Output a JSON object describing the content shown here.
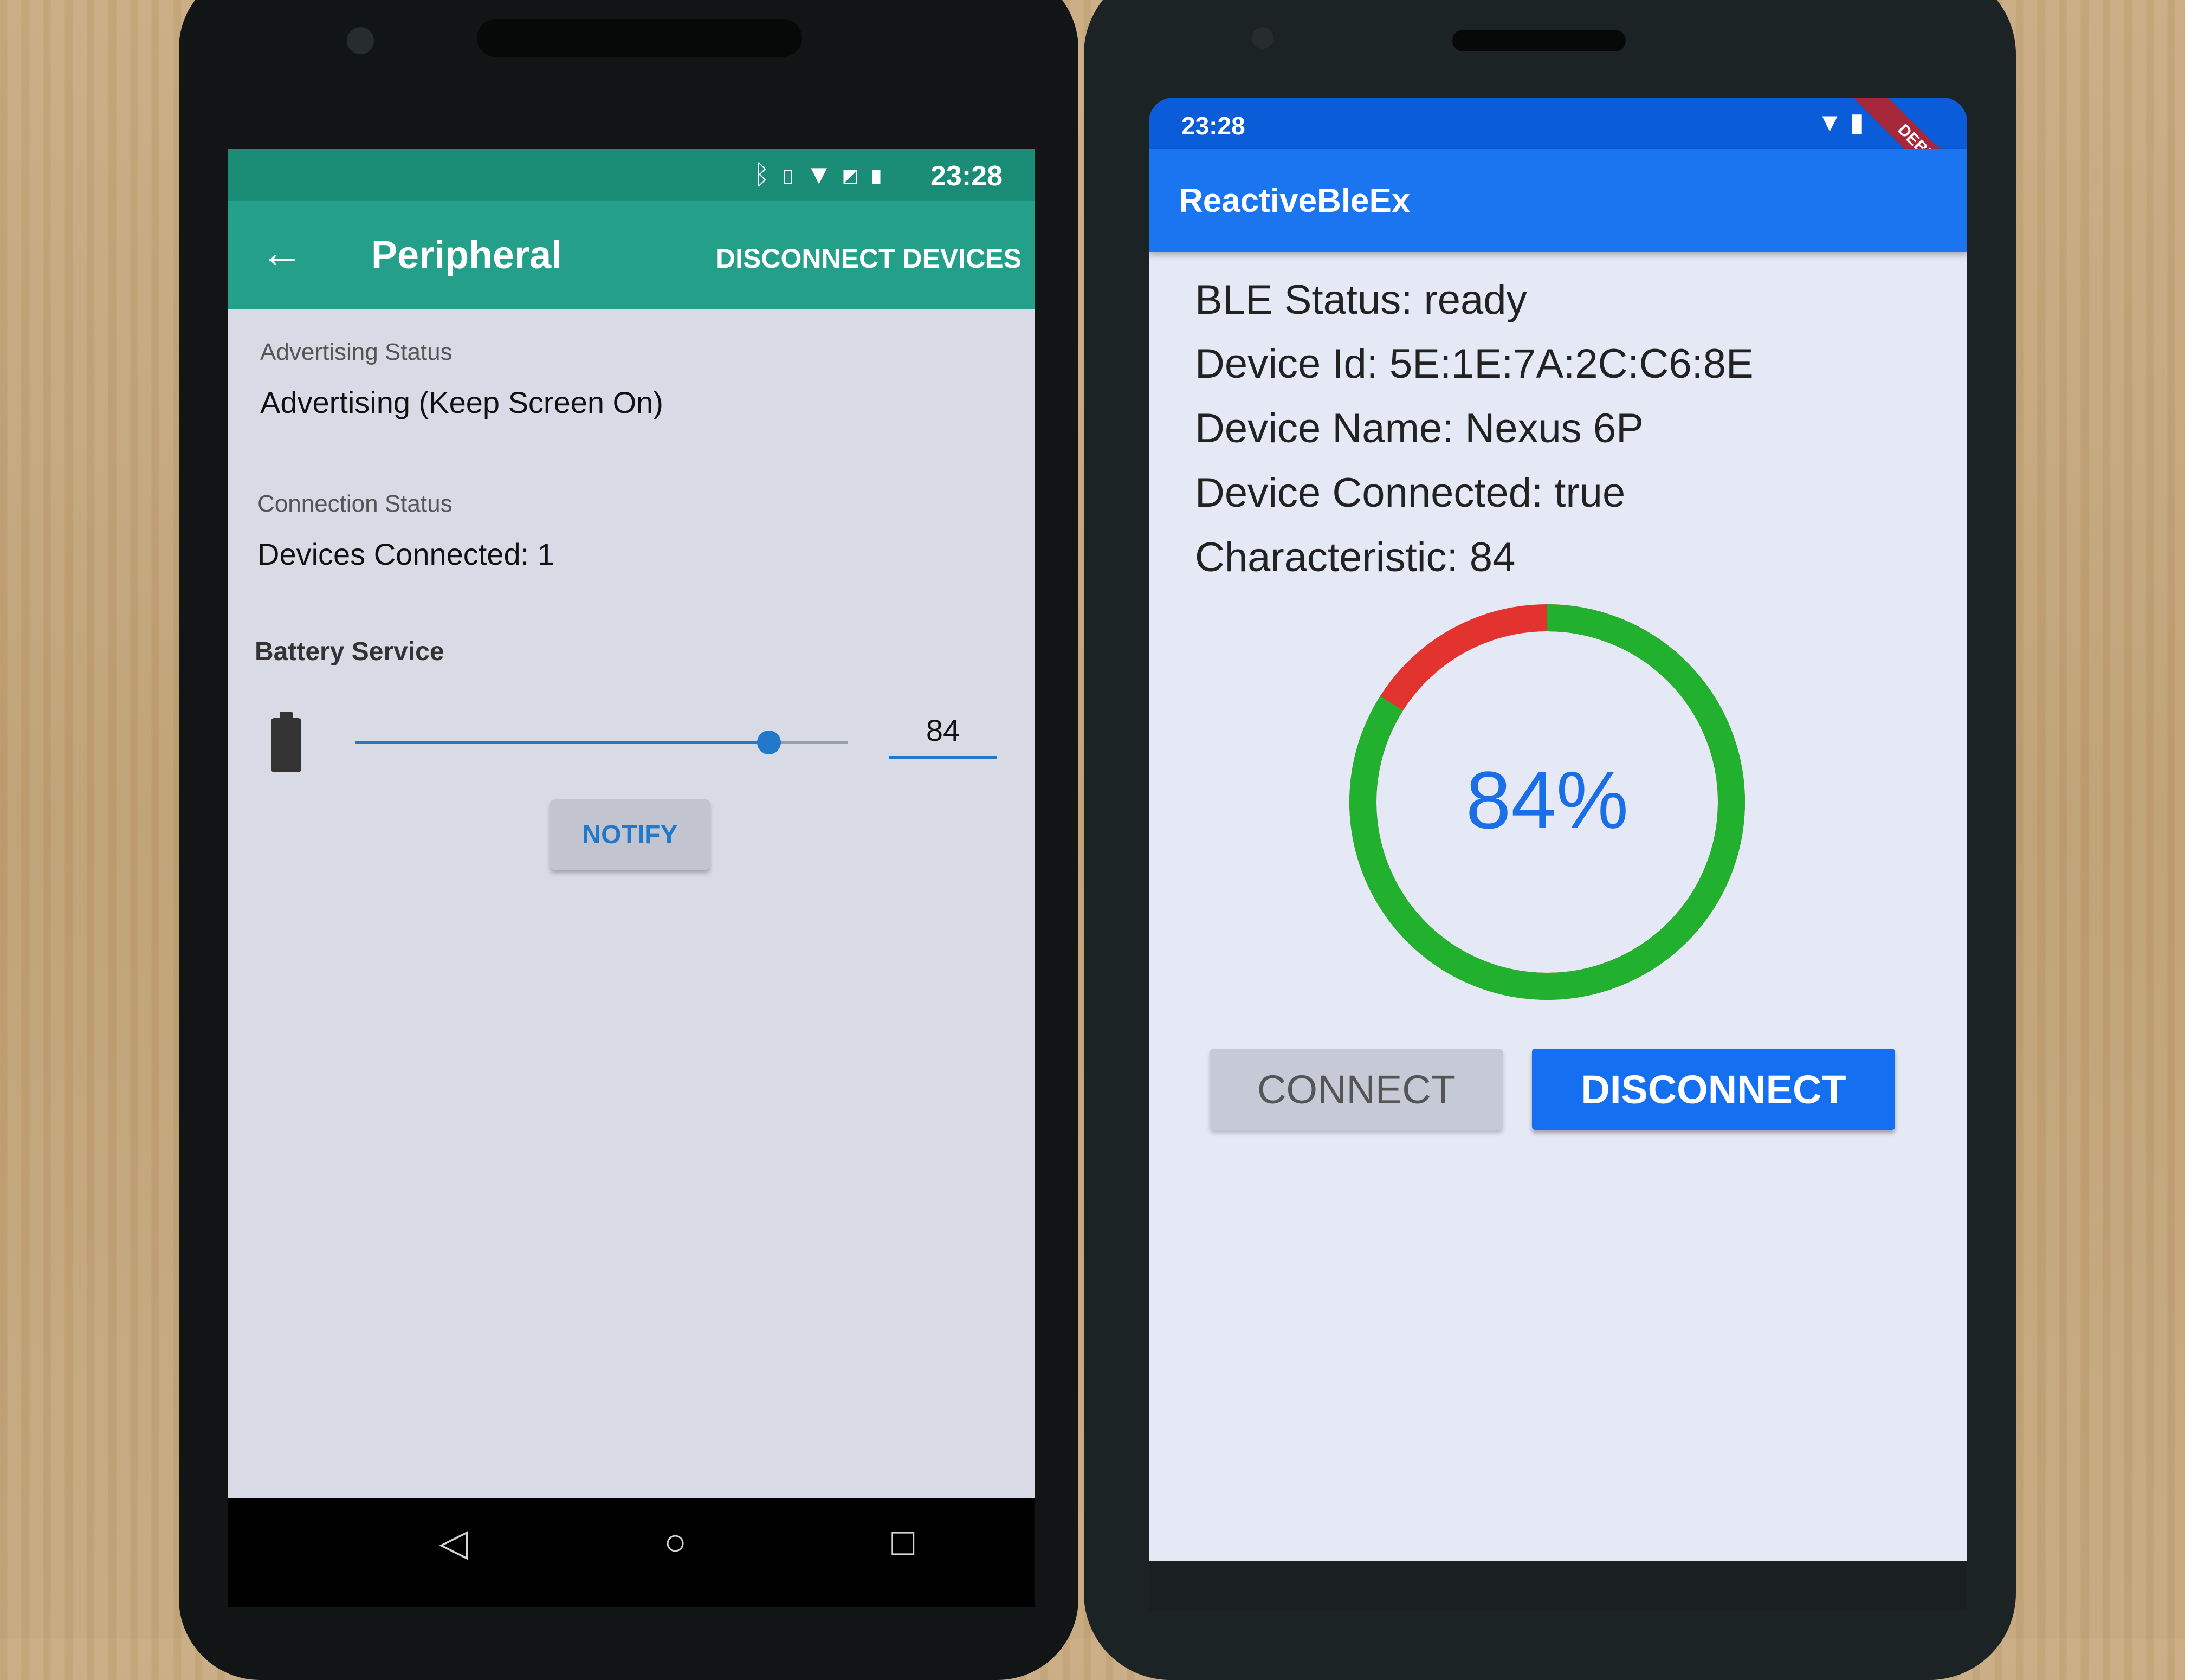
{
  "left_app": {
    "status_bar": {
      "time": "23:28",
      "icons": [
        "bluetooth-icon",
        "vibrate-icon",
        "wifi-icon",
        "no-sim-icon",
        "battery-icon"
      ]
    },
    "app_bar": {
      "back_icon": "back-arrow-icon",
      "title": "Peripheral",
      "action": "DISCONNECT DEVICES"
    },
    "advertising": {
      "label": "Advertising Status",
      "value": "Advertising (Keep Screen On)"
    },
    "connection": {
      "label": "Connection Status",
      "value": "Devices Connected: 1"
    },
    "battery_service": {
      "title": "Battery Service",
      "level": 84,
      "field_value": "84",
      "notify_label": "NOTIFY"
    },
    "nav": {
      "back": "◁",
      "home": "○",
      "recents": "□"
    },
    "colors": {
      "status_bar": "#1b8c76",
      "app_bar": "#24a08a",
      "accent": "#2279c9"
    }
  },
  "right_app": {
    "status_bar": {
      "time": "23:28",
      "icons": [
        "wifi-icon",
        "battery-icon"
      ],
      "debug_banner": "DEBUG"
    },
    "app_bar": {
      "title": "ReactiveBleEx"
    },
    "info": {
      "ble_status": "BLE Status: ready",
      "device_id": "Device Id: 5E:1E:7A:2C:C6:8E",
      "device_name": "Device Name: Nexus 6P",
      "device_connected": "Device Connected: true",
      "characteristic": "Characteristic: 84"
    },
    "gauge": {
      "percent": 84,
      "label": "84%",
      "fill_color": "#22b02f",
      "remain_color": "#e3332f",
      "text_color": "#1a6fe6"
    },
    "buttons": {
      "connect": "CONNECT",
      "disconnect": "DISCONNECT"
    },
    "colors": {
      "status_bar": "#0b5cd9",
      "app_bar": "#1b74f0",
      "primary": "#1470f0"
    }
  }
}
